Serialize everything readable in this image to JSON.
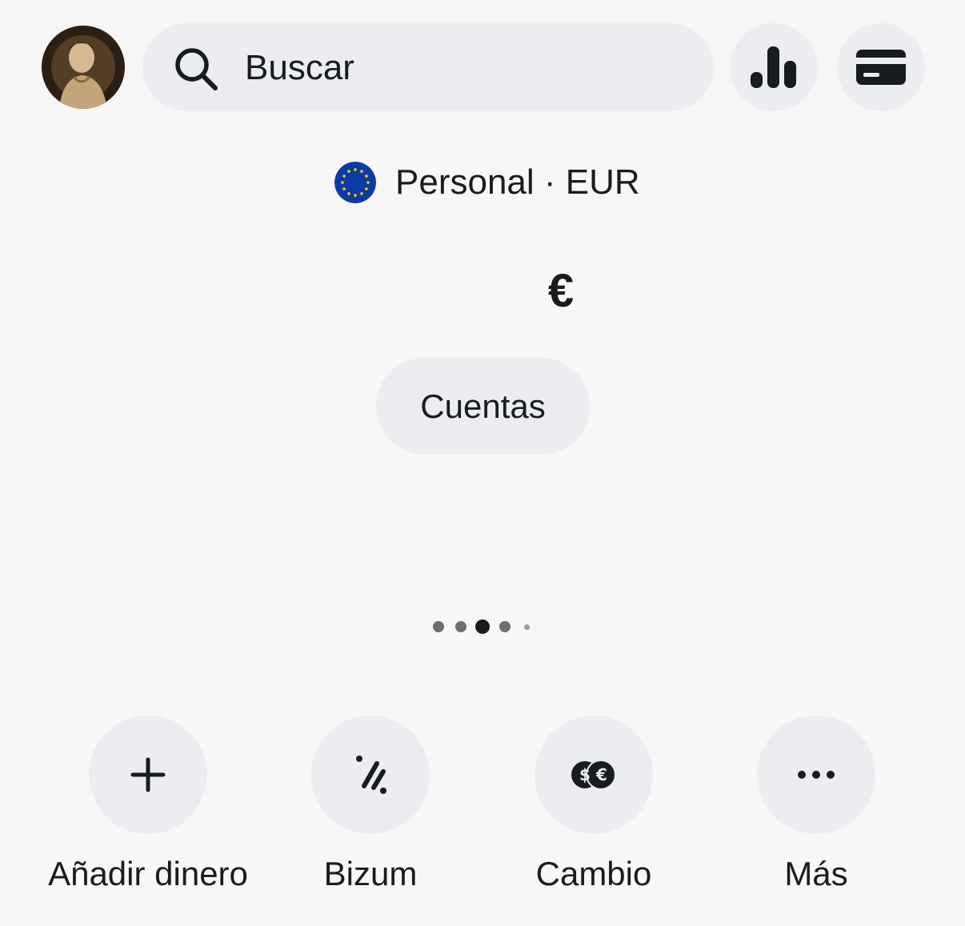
{
  "header": {
    "search": {
      "placeholder": "Buscar"
    },
    "icons": {
      "avatar": "avatar",
      "search": "search-icon",
      "analytics": "bar-chart-icon",
      "cards": "card-icon"
    }
  },
  "account": {
    "label": "Personal · EUR",
    "flag_icon": "eu-flag-icon"
  },
  "balance": {
    "currency_symbol": "€"
  },
  "accounts_button": {
    "label": "Cuentas"
  },
  "pager": {
    "count": 5,
    "active_index": 2
  },
  "actions": [
    {
      "label": "Añadir dinero",
      "icon": "plus-icon"
    },
    {
      "label": "Bizum",
      "icon": "bizum-icon"
    },
    {
      "label": "Cambio",
      "icon": "currency-exchange-icon"
    },
    {
      "label": "Más",
      "icon": "more-icon"
    }
  ],
  "colors": {
    "background": "#f7f7f7",
    "button_background": "#ebedf0",
    "text": "#191c1f",
    "dot": "#6b6e73",
    "eu_blue": "#0e3aa5",
    "eu_star": "#ffcc00"
  }
}
